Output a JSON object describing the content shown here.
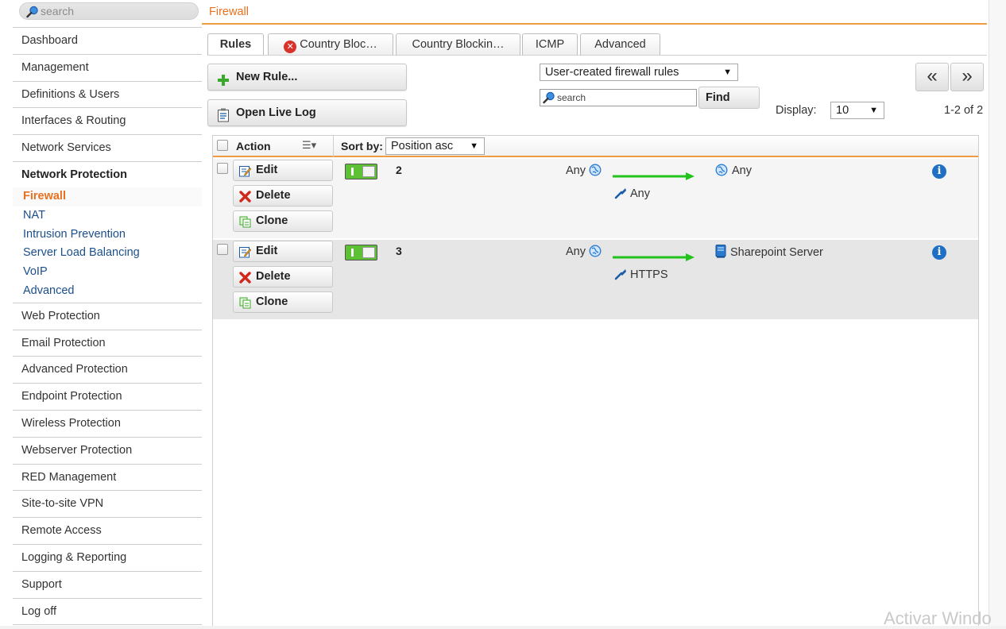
{
  "sidebar": {
    "search_placeholder": "search",
    "items_top": [
      "Dashboard",
      "Management",
      "Definitions & Users",
      "Interfaces & Routing",
      "Network Services"
    ],
    "expanded": {
      "label": "Network Protection",
      "children": [
        "Firewall",
        "NAT",
        "Intrusion Prevention",
        "Server Load Balancing",
        "VoIP",
        "Advanced"
      ],
      "active": "Firewall"
    },
    "items_bottom": [
      "Web Protection",
      "Email Protection",
      "Advanced Protection",
      "Endpoint Protection",
      "Wireless Protection",
      "Webserver Protection",
      "RED Management",
      "Site-to-site VPN",
      "Remote Access",
      "Logging & Reporting",
      "Support",
      "Log off"
    ]
  },
  "header": {
    "breadcrumb": "Firewall"
  },
  "tabs": [
    {
      "label": "Rules",
      "active": true,
      "error": false
    },
    {
      "label": "Country Bloc…",
      "active": false,
      "error": true
    },
    {
      "label": "Country Blockin…",
      "active": false,
      "error": false
    },
    {
      "label": "ICMP",
      "active": false,
      "error": false
    },
    {
      "label": "Advanced",
      "active": false,
      "error": false
    }
  ],
  "toolbar": {
    "new_rule": "New Rule...",
    "open_live_log": "Open Live Log",
    "filter_select": "User-created firewall rules",
    "search_placeholder": "search",
    "find": "Find",
    "display_label": "Display:",
    "display_value": "10",
    "pager_prev": "«",
    "pager_next": "»",
    "pager_count": "1-2 of 2"
  },
  "table": {
    "header_action": "Action",
    "sort_label": "Sort by:",
    "sort_value": "Position asc",
    "buttons": {
      "edit": "Edit",
      "delete": "Delete",
      "clone": "Clone"
    },
    "rows": [
      {
        "position": "2",
        "source": "Any",
        "service": "Any",
        "destination": "Any",
        "destination_icon": "globe-icon",
        "enabled": true
      },
      {
        "position": "3",
        "source": "Any",
        "service": "HTTPS",
        "destination": "Sharepoint Server",
        "destination_icon": "server-icon",
        "enabled": true
      }
    ]
  },
  "watermark": "Activar Windo",
  "colors": {
    "accent": "#e8701e",
    "link": "#1b4f8a",
    "toggle_on": "#5dc233",
    "arrow": "#22c41c",
    "info": "#1f6fc4"
  }
}
